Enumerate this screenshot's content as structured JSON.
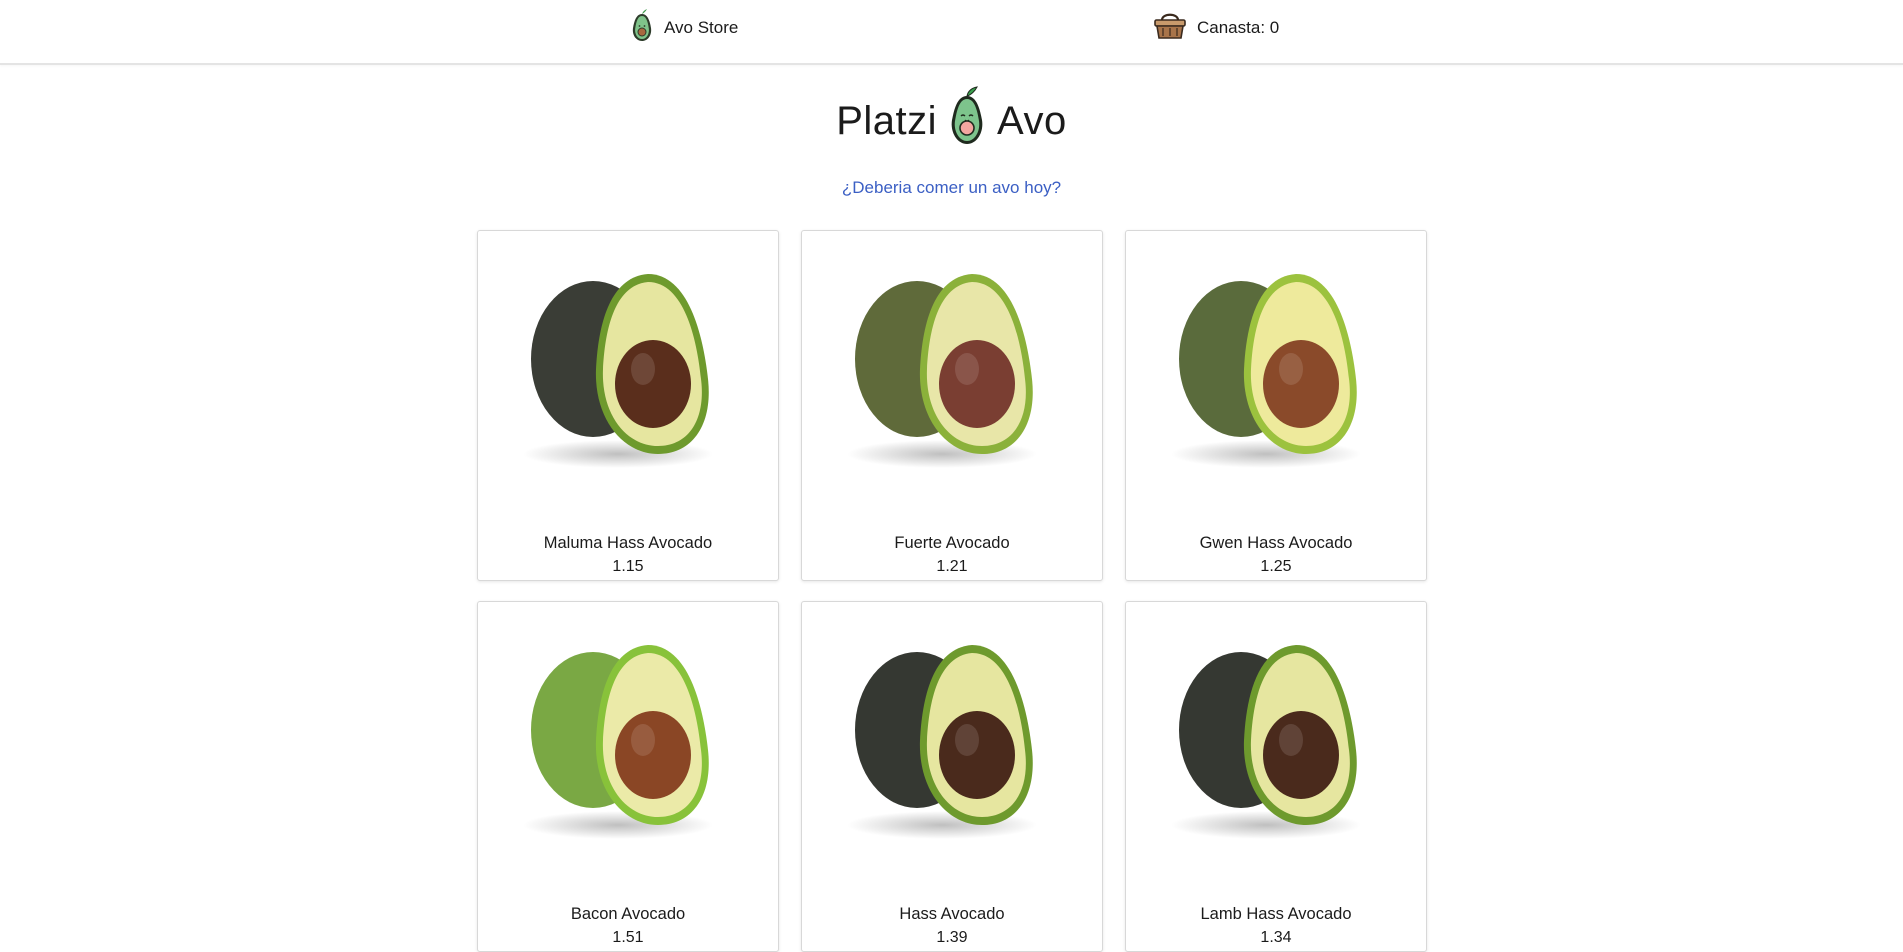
{
  "navbar": {
    "store_label": "Avo Store",
    "basket_label": "Canasta: 0"
  },
  "hero": {
    "title_left": "Platzi",
    "title_right": "Avo",
    "icon": "avocado-mascot-icon"
  },
  "question_link": "¿Deberia comer un avo hoy?",
  "colors": {
    "link": "#3b5fc4",
    "avocado_skin_dark": "#3f4a3a",
    "avocado_flesh": "#d9e08a",
    "avocado_pit": "#6b3a24"
  },
  "products": [
    {
      "name": "Maluma Hass Avocado",
      "price": "1.15"
    },
    {
      "name": "Fuerte Avocado",
      "price": "1.21"
    },
    {
      "name": "Gwen Hass Avocado",
      "price": "1.25"
    },
    {
      "name": "Bacon Avocado",
      "price": "1.51"
    },
    {
      "name": "Hass Avocado",
      "price": "1.39"
    },
    {
      "name": "Lamb Hass Avocado",
      "price": "1.34"
    }
  ]
}
